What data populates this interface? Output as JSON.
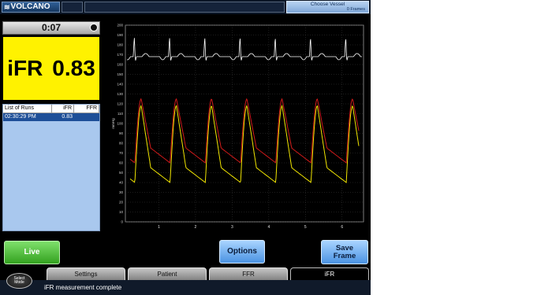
{
  "topbar": {
    "logo_text": "VOLCANO",
    "choose_vessel_label": "Choose Vessel",
    "frames_label": "0 Frames"
  },
  "timer": {
    "value": "0:07"
  },
  "ifr_display": {
    "label": "iFR",
    "value": "0.83",
    "background": "#fff200"
  },
  "runs": {
    "headers": [
      "List of Runs",
      "iFR",
      "FFR"
    ],
    "rows": [
      {
        "time": "02:30:29 PM",
        "ifr": "0.83",
        "ffr": ""
      }
    ]
  },
  "buttons": {
    "live": "Live",
    "options": "Options",
    "save_frame_line1": "Save",
    "save_frame_line2": "Frame"
  },
  "tabs": [
    {
      "label": "Settings",
      "active": false
    },
    {
      "label": "Patient",
      "active": false
    },
    {
      "label": "FFR",
      "active": false
    },
    {
      "label": "iFR",
      "active": true
    }
  ],
  "select_mode": {
    "line1": "Select",
    "line2": "Mode"
  },
  "status": "iFR measurement complete",
  "chart": {
    "ylabel": "mmHg",
    "yticks": [
      200,
      190,
      180,
      170,
      160,
      150,
      140,
      130,
      120,
      110,
      100,
      90,
      80,
      70,
      60,
      50,
      40,
      30,
      20,
      10,
      0
    ],
    "xticks": [
      "1",
      "2",
      "3",
      "4",
      "5",
      "6"
    ],
    "colors": {
      "aortic": "#d01a1a",
      "distal": "#f2e600",
      "ecg": "#ffffff",
      "grid": "#4a4a4a"
    },
    "ecg_beats": 6
  }
}
